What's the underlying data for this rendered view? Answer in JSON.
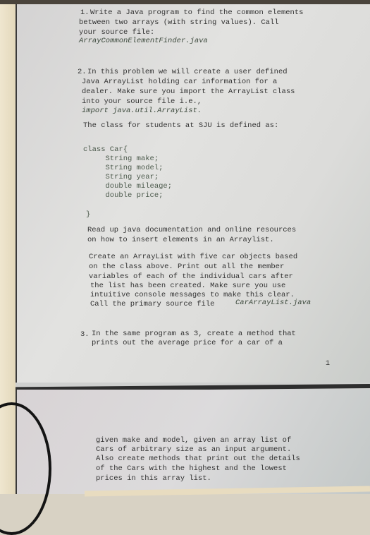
{
  "document": {
    "q1": {
      "number": "1.",
      "lines": [
        "Write a Java program to find the common elements",
        "between two arrays (with string values). Call",
        "your source file:"
      ],
      "filename": "ArrayCommonElementFinder.java"
    },
    "q2": {
      "number": "2.",
      "lines": [
        "In this problem we will create a user defined",
        "Java ArrayList holding car information for a",
        "dealer. Make sure you import the ArrayList class",
        "into your source file i.e.,"
      ],
      "import_line": "import java.util.ArrayList.",
      "class_intro": "The class for students at SJU is defined as:",
      "code": [
        "class Car{",
        "     String make;",
        "     String model;",
        "     String year;",
        "     double mileage;",
        "     double price;",
        "}"
      ],
      "read_up": [
        "Read up java documentation and online resources",
        "on how to insert elements in an Arraylist."
      ],
      "create": [
        "Create an ArrayList with five car objects based",
        "on the class above. Print out all the member",
        "variables of each of the individual cars after",
        "the list has been created. Make sure you use",
        "intuitive console messages to make this clear.",
        "Call the primary source file"
      ],
      "create_filename": "CarArrayList.java"
    },
    "q3": {
      "number": "3.",
      "lines": [
        "In the same program as 3, create a method that",
        "prints out the average price for a car of a"
      ],
      "continuation": [
        "given make and model, given an array list of",
        "Cars of arbitrary size as an input argument.",
        "Also create methods that print out the details",
        "of the Cars with the highest and the lowest",
        "prices in this array list."
      ]
    },
    "page_number": "1"
  }
}
